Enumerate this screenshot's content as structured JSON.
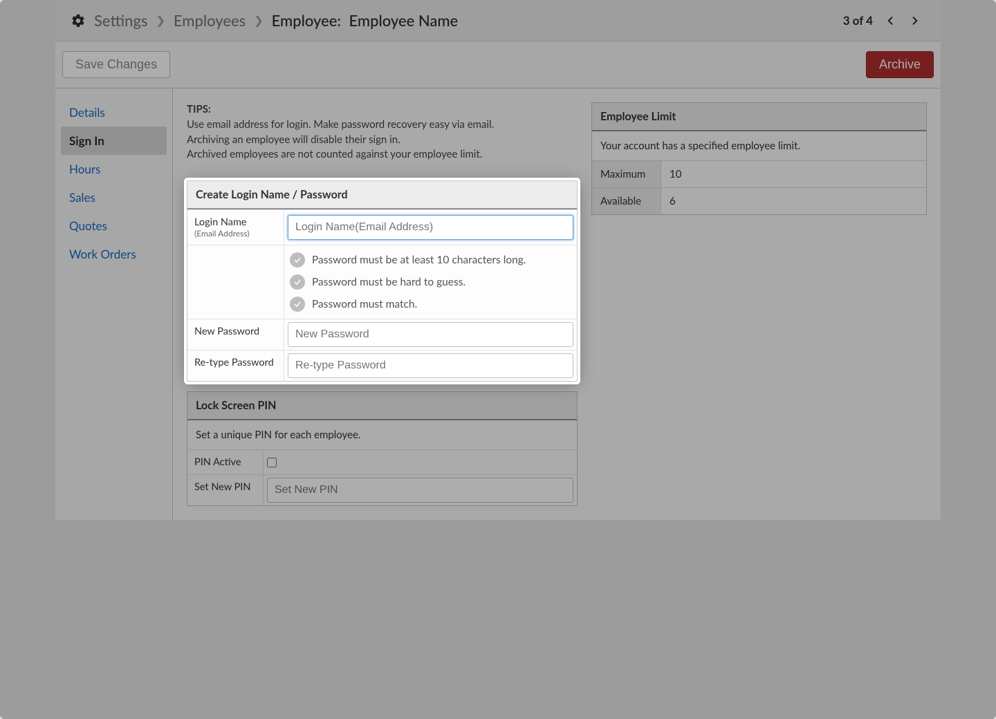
{
  "breadcrumb": {
    "settings": "Settings",
    "employees": "Employees",
    "current_label": "Employee:",
    "current_value": "Employee Name"
  },
  "pager": {
    "text": "3 of 4"
  },
  "actions": {
    "save": "Save Changes",
    "archive": "Archive"
  },
  "sidebar": {
    "tabs": [
      {
        "label": "Details"
      },
      {
        "label": "Sign In"
      },
      {
        "label": "Hours"
      },
      {
        "label": "Sales"
      },
      {
        "label": "Quotes"
      },
      {
        "label": "Work Orders"
      }
    ],
    "active_index": 1
  },
  "tips": {
    "heading": "TIPS:",
    "lines": [
      "Use email address for login. Make password recovery easy via email.",
      "Archiving an employee will disable their sign in.",
      "Archived employees are not counted against your employee limit."
    ]
  },
  "login_panel": {
    "title": "Create Login Name / Password",
    "login_label": "Login Name",
    "login_sublabel": "(Email Address)",
    "login_placeholder": "Login Name(Email Address)",
    "rules": [
      "Password must be at least 10 characters long.",
      "Password must be hard to guess.",
      "Password must match."
    ],
    "newpw_label": "New Password",
    "newpw_placeholder": "New Password",
    "retype_label": "Re-type Password",
    "retype_placeholder": "Re-type Password"
  },
  "pin_panel": {
    "title": "Lock Screen PIN",
    "note": "Set a unique PIN for each employee.",
    "active_label": "PIN Active",
    "active_checked": false,
    "set_label": "Set New PIN",
    "set_placeholder": "Set New PIN"
  },
  "limit_panel": {
    "title": "Employee Limit",
    "note": "Your account has a specified employee limit.",
    "max_label": "Maximum",
    "max_value": "10",
    "avail_label": "Available",
    "avail_value": "6"
  }
}
